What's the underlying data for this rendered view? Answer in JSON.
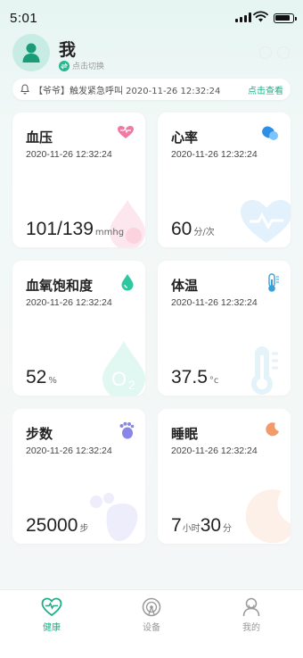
{
  "status_bar": {
    "time": "5:01"
  },
  "header": {
    "title": "我",
    "switch_label": "点击切换"
  },
  "alert": {
    "message": "【爷爷】触发紧急呼叫 2020-11-26 12:32:24",
    "action": "点击查看"
  },
  "cards": [
    {
      "name": "血压",
      "time": "2020-11-26 12:32:24",
      "value": "101/139",
      "unit": "mmhg",
      "icon": "heart-icon"
    },
    {
      "name": "心率",
      "time": "2020-11-26 12:32:24",
      "value": "60",
      "unit": "分/次",
      "icon": "heart-rate-icon"
    },
    {
      "name": "血氧饱和度",
      "time": "2020-11-26 12:32:24",
      "value": "52",
      "unit": "%",
      "icon": "oxygen-drop-icon"
    },
    {
      "name": "体温",
      "time": "2020-11-26 12:32:24",
      "value": "37.5",
      "unit": "°c",
      "icon": "thermometer-icon"
    },
    {
      "name": "步数",
      "time": "2020-11-26 12:32:24",
      "value": "25000",
      "unit": "步",
      "icon": "footprint-icon"
    },
    {
      "name": "睡眠",
      "time": "2020-11-26 12:32:24",
      "value_hours": "7",
      "unit_hours": "小时",
      "value_minutes": "30",
      "unit_minutes": "分",
      "icon": "moon-icon"
    }
  ],
  "tabs": [
    {
      "label": "健康",
      "active": true,
      "icon": "health-icon"
    },
    {
      "label": "设备",
      "active": false,
      "icon": "device-icon"
    },
    {
      "label": "我的",
      "active": false,
      "icon": "profile-icon"
    }
  ],
  "colors": {
    "accent": "#1fae86",
    "inactive": "#999999",
    "background": "#f3f7f7"
  }
}
